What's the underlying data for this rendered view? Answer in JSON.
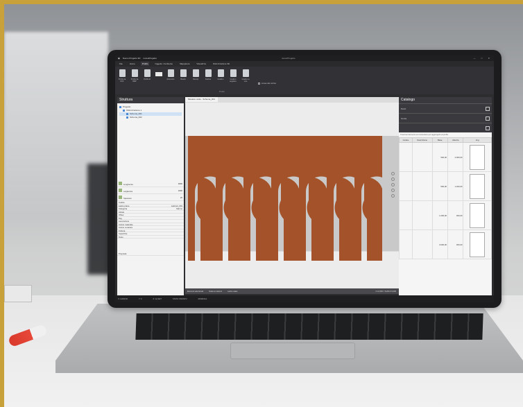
{
  "app": {
    "title_left": "Nuovo Progetto 3D",
    "file_name": "nuovoProgetto",
    "title_center": "nuovoProgetto",
    "window_buttons": [
      "—",
      "□",
      "✕"
    ]
  },
  "menu": {
    "tabs": [
      {
        "label": "File",
        "active": false
      },
      {
        "label": "Home",
        "active": false
      },
      {
        "label": "Profilo",
        "active": true
      },
      {
        "label": "Oggetto / Ambiente",
        "active": false
      },
      {
        "label": "Mappatura",
        "active": false
      },
      {
        "label": "Visualizza",
        "active": false
      },
      {
        "label": "Ottimizzazione 3D",
        "active": false
      }
    ]
  },
  "ribbon": {
    "buttons": [
      {
        "label": "Profilo da DXF",
        "icon": "cursor-icon"
      },
      {
        "label": "Profilo da BMP",
        "icon": "cursor-icon"
      },
      {
        "label": "Profilo di",
        "icon": "cursor-icon"
      },
      {
        "label": "Raccordo",
        "icon": "arc-icon"
      },
      {
        "label": "Bisello",
        "icon": "bevel-icon"
      },
      {
        "label": "Riempi",
        "icon": "fill-icon"
      },
      {
        "label": "Scalina",
        "icon": "stair-icon"
      },
      {
        "label": "Gradino",
        "icon": "step-icon"
      },
      {
        "label": "Gradino angolare",
        "icon": "corner-step-icon"
      },
      {
        "label": "Gradino a viso",
        "icon": "face-step-icon"
      }
    ],
    "input_value": "45,00",
    "checkbox_label": "Linea del colmo",
    "group_label": "Profili"
  },
  "left_panel": {
    "title": "Struttura",
    "tree": [
      {
        "label": "Progetto",
        "indent": 0,
        "selected": false
      },
      {
        "label": "Ottimizzazione 1",
        "indent": 1,
        "selected": false
      },
      {
        "label": "Schema_001",
        "indent": 2,
        "selected": true
      },
      {
        "label": "Schema_002",
        "indent": 2,
        "selected": false
      }
    ],
    "props": [
      {
        "label": "Lunghezza",
        "value": "3800",
        "big": true
      },
      {
        "label": "Larghezza",
        "value": "1800",
        "big": true
      },
      {
        "label": "Spessore",
        "value": "20",
        "big": true
      },
      {
        "label": "Codice",
        "value": "",
        "big": false
      },
      {
        "label": "Lastre piane",
        "value": "Lastroni_001",
        "big": false
      },
      {
        "label": "Categoria",
        "value": "Marmo",
        "big": false
      },
      {
        "label": "Infinito",
        "value": "",
        "big": false
      },
      {
        "label": "Offset",
        "value": "",
        "big": false
      },
      {
        "label": "Tag",
        "value": "",
        "big": false
      },
      {
        "label": "Lavorazione",
        "value": "",
        "big": false
      },
      {
        "label": "Colore materiale",
        "value": "",
        "big": false
      },
      {
        "label": "Colore venatura",
        "value": "",
        "big": false
      },
      {
        "label": "Finitura",
        "value": "",
        "big": false
      },
      {
        "label": "Superficie",
        "value": "",
        "big": false
      }
    ],
    "section_label": "Testo",
    "footer": "Proprietà"
  },
  "center": {
    "doc_tab": "Mosaico onde - Schema_001",
    "status": [
      "Elementi selezionati",
      "Scala su lastroni",
      "Lastre usate"
    ],
    "coords": "X 12,500  Y 8,200  Z 0,000"
  },
  "right_panel": {
    "title": "Catalogo",
    "sections": [
      {
        "label": "Pezzi",
        "icon": "grid-icon"
      },
      {
        "label": "Cerca",
        "icon": "search-icon"
      },
      {
        "label": "",
        "icon": "home-icon"
      }
    ],
    "note": "Trascina l'elemento sul contenitore per aggiungerlo al profilo",
    "columns": [
      "Codice",
      "Descrizione",
      "Base",
      "Altezza",
      "Img"
    ],
    "rows": [
      {
        "base": "500,00",
        "height": "2.000,00"
      },
      {
        "base": "500,00",
        "height": "1.200,00"
      },
      {
        "base": "1.200,00",
        "height": "300,00"
      },
      {
        "base": "3.000,00",
        "height": "300,00"
      }
    ]
  },
  "bottom": {
    "items": [
      "X: 12459,52",
      "Y: 0",
      "Z: 12,4327",
      "STATO: PRONTO",
      "MODIFICA"
    ]
  },
  "colors": {
    "tile": "#a3522a",
    "frame": "#c9a13a"
  }
}
